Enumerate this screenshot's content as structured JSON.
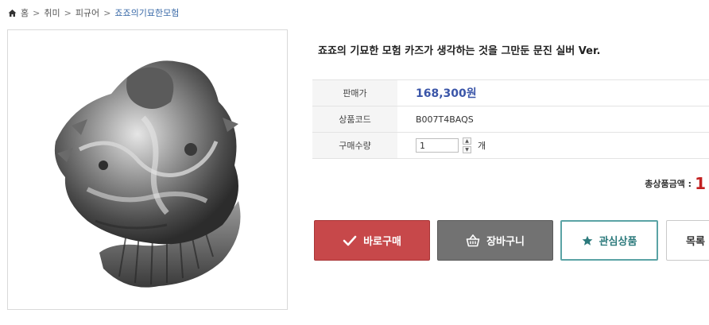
{
  "breadcrumb": {
    "items": [
      "홈",
      "취미",
      "피규어",
      "죠죠의기묘한모험"
    ],
    "separator": ">"
  },
  "product": {
    "title": "죠죠의 기묘한 모험 카즈가 생각하는 것을 그만둔 문진 실버 Ver.",
    "price_label": "판매가",
    "price": "168,300원",
    "code_label": "상품코드",
    "code": "B007T4BAQS",
    "qty_label": "구매수량",
    "qty_value": "1",
    "qty_unit": "개"
  },
  "total": {
    "label": "총상품금액 :",
    "value": "1"
  },
  "buttons": {
    "buy": "바로구매",
    "cart": "장바구니",
    "wish": "관심상품",
    "list": "목록"
  },
  "colors": {
    "buy": "#c7484a",
    "cart": "#727272",
    "wish_border": "#5aa3a5",
    "price": "#3a55a8",
    "total": "#c22020"
  }
}
